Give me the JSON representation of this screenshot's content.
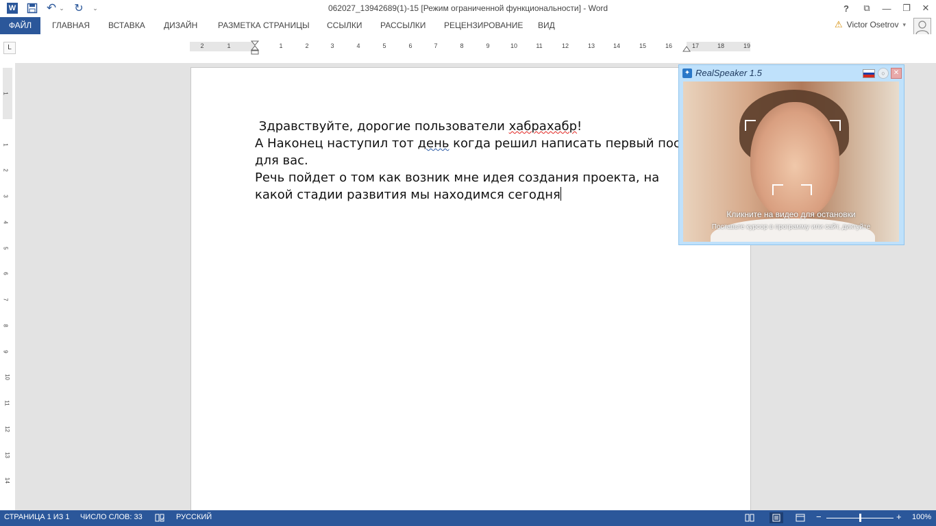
{
  "window": {
    "title": "062027_13942689(1)-15 [Режим ограниченной функциональности] - Word",
    "controls": {
      "help": "?",
      "ribbon_display": "⧉",
      "minimize": "—",
      "restore": "❐",
      "close": "✕"
    }
  },
  "quick_access": {
    "word_icon": "W",
    "save_icon": "save-icon",
    "undo_glyph": "↶",
    "redo_glyph": "↻",
    "customize_glyph": "⌄"
  },
  "ribbon": {
    "tabs": [
      "ФАЙЛ",
      "ГЛАВНАЯ",
      "ВСТАВКА",
      "ДИЗАЙН",
      "РАЗМЕТКА СТРАНИЦЫ",
      "ССЫЛКИ",
      "РАССЫЛКИ",
      "РЕЦЕНЗИРОВАНИЕ",
      "ВИД"
    ],
    "account_name": "Victor Osetrov",
    "warning_glyph": "⚠"
  },
  "ruler": {
    "tab_selector": "L",
    "horizontal_labels": [
      "2",
      "1",
      "",
      "1",
      "2",
      "3",
      "4",
      "5",
      "6",
      "7",
      "8",
      "9",
      "10",
      "11",
      "12",
      "13",
      "14",
      "15",
      "16",
      "17",
      "18",
      "19"
    ],
    "vertical_labels": [
      "1",
      "1",
      "2",
      "3",
      "4",
      "5",
      "6",
      "7",
      "8",
      "9",
      "10",
      "11",
      "12",
      "13",
      "14"
    ]
  },
  "document": {
    "line1_pre": " Здравствуйте, дорогие пользователи ",
    "line1_spell": "хабрахабр",
    "line1_post": "!",
    "line2_pre": "А Наконец наступил тот ",
    "line2_grammar": "день",
    "line2_post": " когда решил написать первый пост для вас.",
    "line3": "Речь пойдет о том как возник мне идея создания проекта, на какой стадии развития мы находимся сегодня"
  },
  "realspeaker": {
    "title": "RealSpeaker 1.5",
    "hint_stop": "Кликните на видео для остановки",
    "hint_cursor": "Поставьте курсор в программу или сайт, диктуйте",
    "flag_colors": [
      "#ffffff",
      "#1c3fa8",
      "#d52b1e"
    ]
  },
  "status": {
    "page": "СТРАНИЦА 1 ИЗ 1",
    "words": "ЧИСЛО СЛОВ: 33",
    "language": "РУССКИЙ",
    "zoom_minus": "−",
    "zoom_plus": "+",
    "zoom_percent": "100%",
    "zoom_level": 0.5
  },
  "colors": {
    "accent": "#2b579a",
    "spell_error": "#e0201c",
    "grammar_error": "#2b5aa6"
  }
}
